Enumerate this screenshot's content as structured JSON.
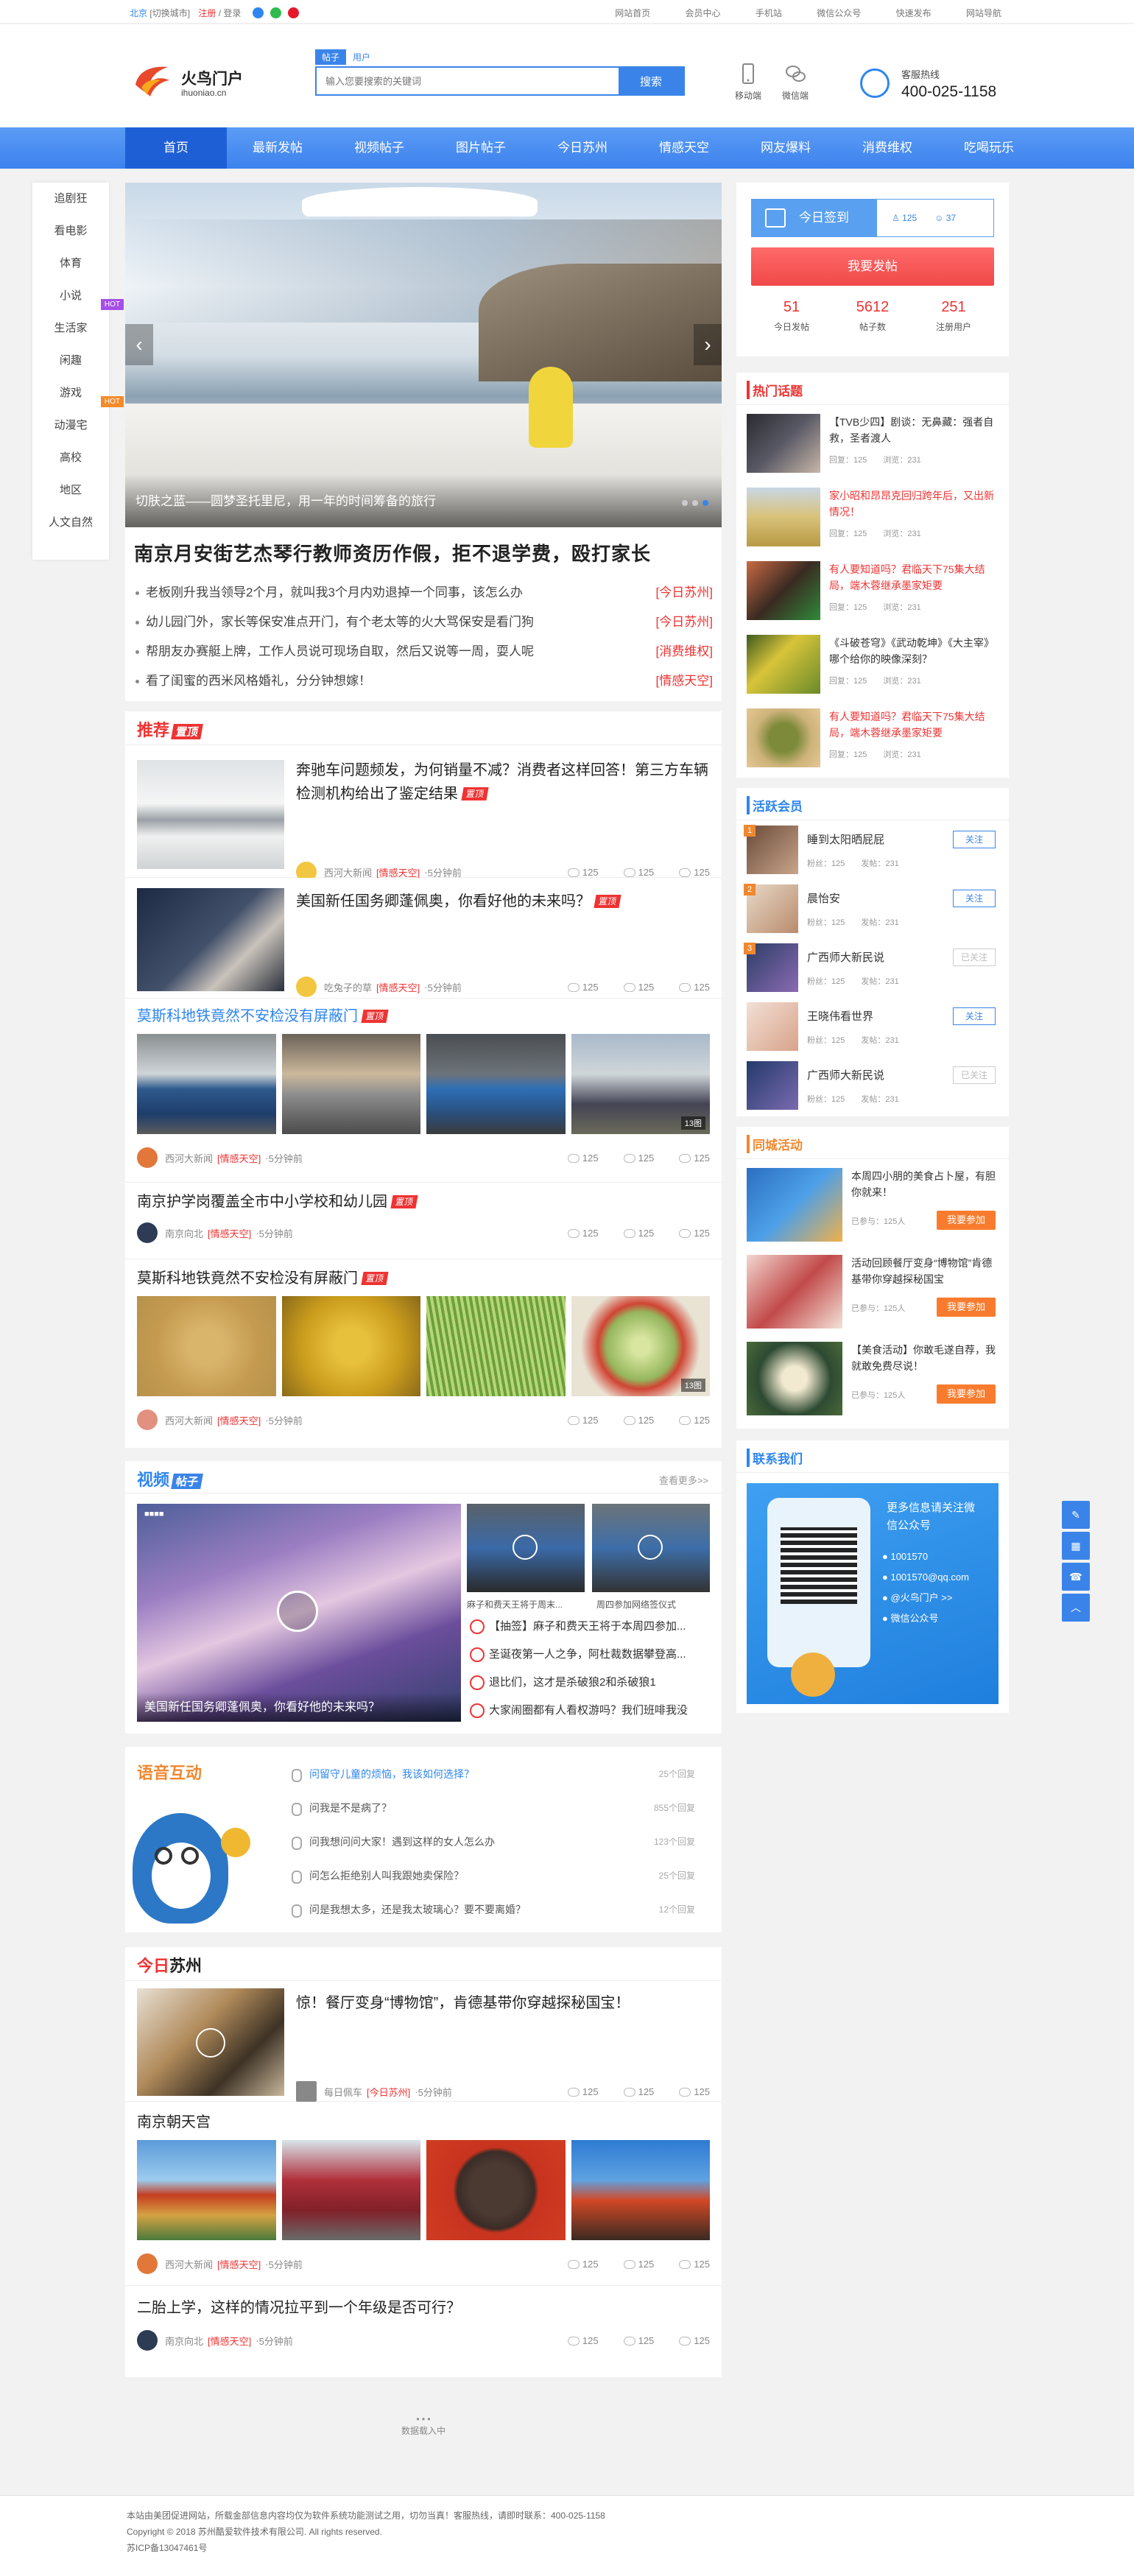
{
  "topbar": {
    "city": "北京",
    "switch": "[切换城市]",
    "register": "注册",
    "login": "登录",
    "links": [
      "网站首页",
      "会员中心",
      "手机站",
      "微信公众号",
      "快速发布",
      "网站导航"
    ]
  },
  "header": {
    "logo_title": "火鸟门户",
    "logo_domain": "ihuoniao.cn",
    "search_tabs": [
      "帖子",
      "用户"
    ],
    "search_placeholder": "输入您要搜索的关键词",
    "search_button": "搜索",
    "mobile_label": "移动端",
    "wechat_label": "微信端",
    "hotline_label": "客服热线",
    "hotline_number": "400-025-1158"
  },
  "nav": [
    "首页",
    "最新发帖",
    "视频帖子",
    "图片帖子",
    "今日苏州",
    "情感天空",
    "网友爆料",
    "消费维权",
    "吃喝玩乐"
  ],
  "sidebar": [
    {
      "label": "追剧狂"
    },
    {
      "label": "看电影"
    },
    {
      "label": "体育"
    },
    {
      "label": "小说",
      "tag": "HOT"
    },
    {
      "label": "生活家"
    },
    {
      "label": "闲趣"
    },
    {
      "label": "游戏",
      "tag": "HOT"
    },
    {
      "label": "动漫宅"
    },
    {
      "label": "高校"
    },
    {
      "label": "地区"
    },
    {
      "label": "人文自然"
    }
  ],
  "banner": {
    "caption": "切肤之蓝——圆梦圣托里尼，用一年的时间筹备的旅行"
  },
  "headline": {
    "title": "南京月安街艺杰琴行教师资历作假，拒不退学费，殴打家长",
    "items": [
      {
        "text": "老板刚升我当领导2个月，就叫我3个月内劝退掉一个同事，该怎么办",
        "tag": "[今日苏州]"
      },
      {
        "text": "幼儿园门外，家长等保安准点开门，有个老太等的火大骂保安是看门狗",
        "tag": "[今日苏州]"
      },
      {
        "text": "帮朋友办赛艇上牌，工作人员说可现场自取，然后又说等一周，耍人呢",
        "tag": "[消费维权]"
      },
      {
        "text": "看了闺蜜的西米风格婚礼，分分钟想嫁！",
        "tag": "[情感天空]"
      }
    ]
  },
  "recommend": {
    "title": "推荐",
    "badge": "置顶",
    "stickbadge": "置顶",
    "stats": [
      "125",
      "125",
      "125"
    ],
    "articles": [
      {
        "title": "奔驰车问题频发，为何销量不减？消费者这样回答！第三方车辆检测机构给出了鉴定结果",
        "author": "西河大新闻",
        "tag": "[情感天空]",
        "time": "5分钟前"
      },
      {
        "title": "美国新任国务卿蓬佩奥，你看好他的未来吗？",
        "author": "吃兔子的草",
        "tag": "[情感天空]",
        "time": "5分钟前"
      },
      {
        "title": "莫斯科地铁竟然不安检没有屏蔽门",
        "author": "西河大新闻",
        "tag": "[情感天空]",
        "time": "5分钟前",
        "count": "13图"
      },
      {
        "title": "南京护学岗覆盖全市中小学校和幼儿园",
        "author": "南京向北",
        "tag": "[情感天空]",
        "time": "5分钟前"
      },
      {
        "title": "莫斯科地铁竟然不安检没有屏蔽门",
        "author": "西河大新闻",
        "tag": "[情感天空]",
        "time": "5分钟前",
        "count": "13图"
      }
    ]
  },
  "video": {
    "title": "视频",
    "badge": "帖子",
    "more": "查看更多>>",
    "big_caption": "美国新任国务卿蓬佩奥，你看好他的未来吗？",
    "small": [
      "麻子和费天王将于周末...",
      "周四参加网络签仪式"
    ],
    "list": [
      "【抽签】麻子和费天王将于本周四参加...",
      "圣诞夜第一人之争，阿杜裁数据攀登高...",
      "退比们，这才是杀破狼2和杀破狼1",
      "大家闹圈都有人看权游吗？我们班啡我没"
    ]
  },
  "voice": {
    "title": "语音互动",
    "items": [
      {
        "q": "问留守儿童的烦恼，我该如何选择？",
        "n": "25个回复"
      },
      {
        "q": "问我是不是病了？",
        "n": "855个回复"
      },
      {
        "q": "问我想问问大家！遇到这样的女人怎么办",
        "n": "123个回复"
      },
      {
        "q": "问怎么拒绝别人叫我跟她卖保险？",
        "n": "25个回复"
      },
      {
        "q": "问是我想太多，还是我太玻璃心？要不要离婚？",
        "n": "12个回复"
      }
    ]
  },
  "today": {
    "title1": "今日",
    "title2": "苏州",
    "articles": [
      {
        "title": "惊！餐厅变身“博物馆”，肯德基带你穿越探秘国宝！",
        "author": "每日佩车",
        "tag": "[今日苏州]",
        "time": "5分钟前"
      },
      {
        "title": "南京朝天宫",
        "author": "西河大新闻",
        "tag": "[情感天空]",
        "time": "5分钟前"
      },
      {
        "title": "二胎上学，这样的情况拉平到一个年级是否可行？",
        "author": "南京向北",
        "tag": "[情感天空]",
        "time": "5分钟前"
      }
    ]
  },
  "loading": "数据载入中",
  "user": {
    "signin": "今日签到",
    "fans": "125",
    "follow": "37",
    "post_btn": "我要发帖",
    "stats": [
      {
        "v": "51",
        "l": "今日发帖"
      },
      {
        "v": "5612",
        "l": "帖子数"
      },
      {
        "v": "251",
        "l": "注册用户"
      }
    ]
  },
  "hot": {
    "title": "热门话题",
    "items": [
      {
        "t": "【TVB少四】剧谈：无鼻藏：强者自救，圣者渡人",
        "r": false
      },
      {
        "t": "家小昭和昂昂克回归跨年后，又出新情况！",
        "r": true
      },
      {
        "t": "有人要知道吗？君临天下75集大结局，端木蓉继承墨家矩要",
        "r": true
      },
      {
        "t": "《斗破苍穹》《武动乾坤》《大主宰》哪个给你的映像深刻？",
        "r": false
      },
      {
        "t": "有人要知道吗？君临天下75集大结局，端木蓉继承墨家矩要",
        "r": true
      }
    ],
    "meta": "回复：125　　浏览：231"
  },
  "members": {
    "title": "活跃会员",
    "items": [
      {
        "n": "睡到太阳晒屁屁",
        "f": "关注",
        "d": false
      },
      {
        "n": "晨怡安",
        "f": "关注",
        "d": false
      },
      {
        "n": "广西师大新民说",
        "f": "已关注",
        "d": true
      },
      {
        "n": "王晓伟看世界",
        "f": "关注",
        "d": false
      },
      {
        "n": "广西师大新民说",
        "f": "已关注",
        "d": true
      }
    ],
    "meta": "粉丝：125　　发帖：231"
  },
  "activity": {
    "title": "同城活动",
    "items": [
      {
        "t": "本周四小朋的美食占卜屋，有胆你就来！",
        "c": "已参与：125人"
      },
      {
        "t": "活动回顾餐厅变身“博物馆”肯德基带你穿越探秘国宝",
        "c": "已参与：125人"
      },
      {
        "t": "【美食活动】你敢毛遂自荐，我就敢免费尽说！",
        "c": "已参与：125人"
      }
    ],
    "join": "我要参加"
  },
  "contact": {
    "title": "联系我们",
    "follow_text": "更多信息请关注微信公众号",
    "phone": "1001570",
    "email": "1001570@qq.com",
    "site": "@火鸟门户 >>",
    "wechat": "微信公众号"
  },
  "footer": {
    "line1": "本站由美团促进网站，所载金部信息内容均仅为软件系统功能测试之用，切勿当真！客服热线，请即时联系：400-025-1158",
    "line2": "Copyright © 2018 苏州酷爱软件技术有限公司. All rights reserved.",
    "line3": "苏ICP备13047461号"
  },
  "pagination_dots": "• • •",
  "colors": {
    "accent": "#3a84e9",
    "red": "#ee3333",
    "orange": "#f08830"
  }
}
